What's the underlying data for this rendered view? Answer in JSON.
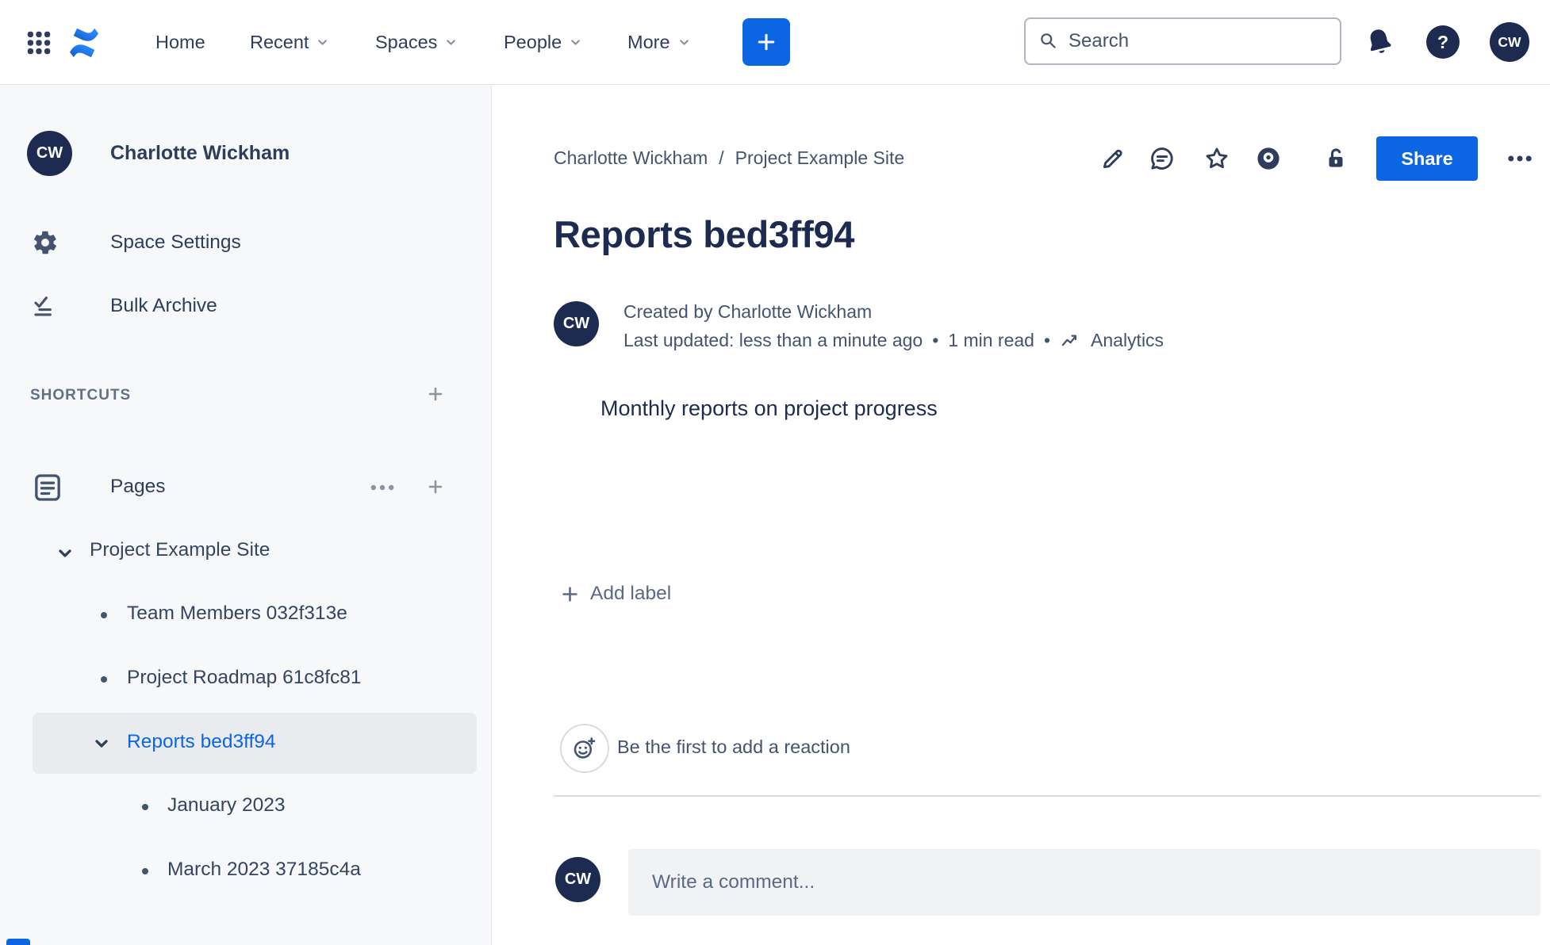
{
  "user": {
    "initials": "CW",
    "name": "Charlotte Wickham"
  },
  "colors": {
    "accent_blue": "#0C66E4",
    "avatar_navy": "#1D2B50",
    "sidebar_bg": "#F7F8F9",
    "selected_row_bg": "#E9EBEE"
  },
  "navbar": {
    "menu": [
      {
        "label": "Home"
      },
      {
        "label": "Recent"
      },
      {
        "label": "Spaces"
      },
      {
        "label": "People"
      },
      {
        "label": "More"
      }
    ],
    "search_placeholder": "Search",
    "help_glyph": "?"
  },
  "sidebar": {
    "profile_name": "Charlotte Wickham",
    "items": [
      {
        "label": "Space Settings"
      },
      {
        "label": "Bulk Archive"
      }
    ],
    "shortcuts_heading": "SHORTCUTS",
    "pages_label": "Pages",
    "tree": {
      "root_label": "Project Example Site",
      "children": [
        {
          "label": "Team Members 032f313e"
        },
        {
          "label": "Project Roadmap 61c8fc81"
        },
        {
          "label": "Reports bed3ff94",
          "selected": true
        }
      ],
      "reports_children": [
        {
          "label": "January 2023"
        },
        {
          "label": "March 2023 37185c4a"
        }
      ]
    }
  },
  "content": {
    "breadcrumb": {
      "parent": "Charlotte Wickham",
      "separator": "/",
      "current": "Project Example Site"
    },
    "share_label": "Share",
    "title": "Reports bed3ff94",
    "byline": {
      "created": "Created by Charlotte Wickham",
      "last_updated": "Last updated: less than a minute ago",
      "dot": "•",
      "read_time": "1 min read",
      "analytics_label": "Analytics"
    },
    "body_text": "Monthly reports on project progress",
    "add_label_text": "Add label",
    "reaction_prompt": "Be the first to add a reaction",
    "comment_placeholder": "Write a comment..."
  }
}
